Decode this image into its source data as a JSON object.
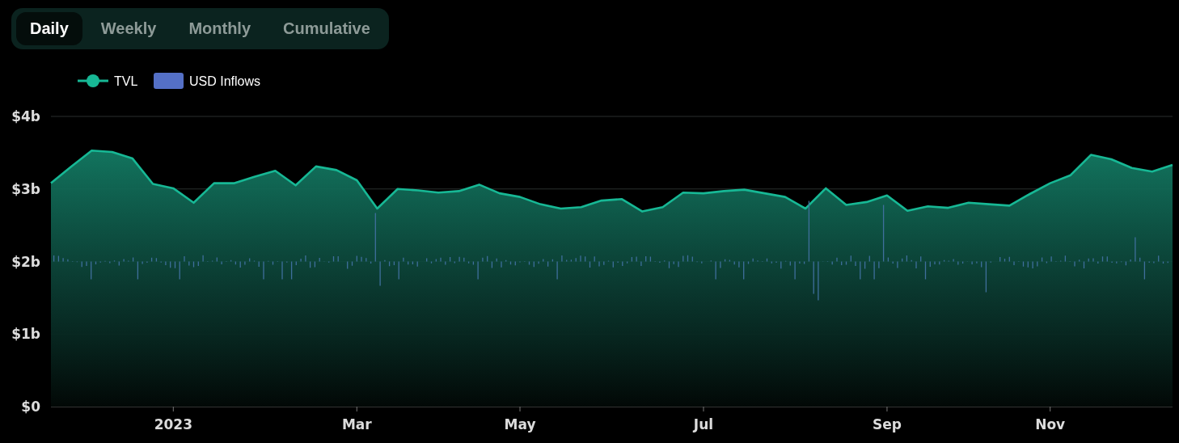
{
  "tabs": [
    {
      "label": "Daily",
      "selected": true
    },
    {
      "label": "Weekly",
      "selected": false
    },
    {
      "label": "Monthly",
      "selected": false
    },
    {
      "label": "Cumulative",
      "selected": false
    }
  ],
  "legend": [
    {
      "label": "USD Inflows",
      "kind": "bar",
      "color": "#5470c6"
    }
  ],
  "chart_data": {
    "type": "area",
    "categories": [
      null,
      null,
      null,
      null,
      null,
      null,
      "2023",
      null,
      null,
      null,
      null,
      null,
      null,
      null,
      null,
      "Mar",
      null,
      null,
      null,
      null,
      null,
      null,
      null,
      "May",
      null,
      null,
      null,
      null,
      null,
      null,
      null,
      null,
      "Jul",
      null,
      null,
      null,
      null,
      null,
      null,
      null,
      null,
      "Sep",
      null,
      null,
      null,
      null,
      null,
      null,
      null,
      "Nov",
      null,
      null,
      null,
      null,
      null,
      null
    ],
    "series": [
      {
        "name": "TVL",
        "color": "#17b895",
        "values": [
          3.08,
          3.31,
          3.53,
          3.51,
          3.42,
          3.07,
          3.01,
          2.81,
          3.08,
          3.08,
          3.17,
          3.25,
          3.05,
          3.31,
          3.26,
          3.12,
          2.73,
          3.0,
          2.98,
          2.95,
          2.97,
          3.06,
          2.94,
          2.89,
          2.79,
          2.73,
          2.75,
          2.84,
          2.86,
          2.69,
          2.75,
          2.95,
          2.94,
          2.97,
          2.99,
          2.94,
          2.89,
          2.73,
          3.01,
          2.78,
          2.82,
          2.91,
          2.7,
          2.76,
          2.74,
          2.81,
          2.79,
          2.77,
          2.93,
          3.08,
          3.19,
          3.47,
          3.41,
          3.29,
          3.24,
          3.33
        ]
      }
    ],
    "ylim": [
      0,
      4
    ],
    "yticks": [
      {
        "value": 0,
        "label": "$0"
      },
      {
        "value": 1,
        "label": "$1b"
      },
      {
        "value": 2,
        "label": "$2b"
      },
      {
        "value": 3,
        "label": "$3b"
      },
      {
        "value": 4,
        "label": "$4b"
      }
    ]
  }
}
